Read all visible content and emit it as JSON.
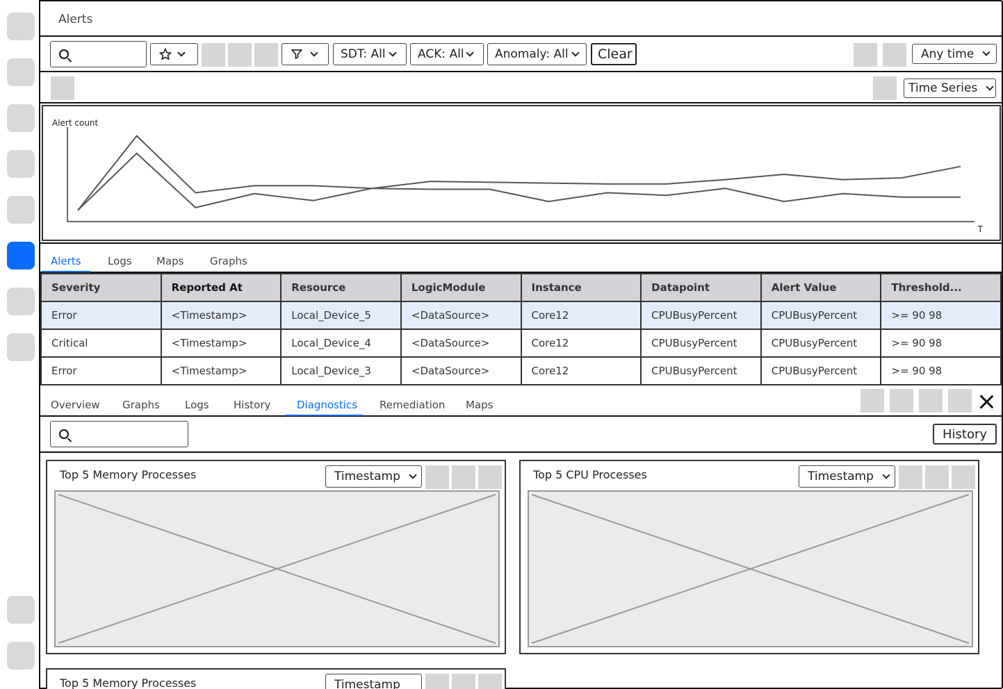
{
  "title": "Alerts",
  "toolbar": {
    "search_placeholder": "",
    "sdt_label": "SDT: All",
    "ack_label": "ACK: All",
    "anomaly_label": "Anomaly: All",
    "clear_label": "Clear",
    "time_range": "Any time"
  },
  "view": {
    "selected": "Time Series"
  },
  "chart_data": {
    "type": "line",
    "ylabel": "Alert count",
    "xlabel": "T",
    "series": [
      {
        "values": [
          0.05,
          0.9,
          0.25,
          0.33,
          0.33,
          0.3,
          0.38,
          0.37,
          0.36,
          0.35,
          0.35,
          0.4,
          0.46,
          0.4,
          0.42,
          0.55
        ]
      },
      {
        "values": [
          0.05,
          0.7,
          0.08,
          0.24,
          0.16,
          0.3,
          0.29,
          0.29,
          0.15,
          0.25,
          0.22,
          0.3,
          0.15,
          0.24,
          0.2,
          0.2
        ]
      }
    ]
  },
  "tabs_top": [
    "Alerts",
    "Logs",
    "Maps",
    "Graphs"
  ],
  "table": {
    "columns": [
      "Severity",
      "Reported At",
      "Resource",
      "LogicModule",
      "Instance",
      "Datapoint",
      "Alert Value",
      "Threshold..."
    ],
    "rows": [
      [
        "Error",
        "<Timestamp>",
        "Local_Device_5",
        "<DataSource>",
        "Core12",
        "CPUBusyPercent",
        "CPUBusyPercent",
        ">= 90 98"
      ],
      [
        "Critical",
        "<Timestamp>",
        "Local_Device_4",
        "<DataSource>",
        "Core12",
        "CPUBusyPercent",
        "CPUBusyPercent",
        ">= 90 98"
      ],
      [
        "Error",
        "<Timestamp>",
        "Local_Device_3",
        "<DataSource>",
        "Core12",
        "CPUBusyPercent",
        "CPUBusyPercent",
        ">= 90 98"
      ]
    ]
  },
  "tabs_detail": [
    "Overview",
    "Graphs",
    "Logs",
    "History",
    "Diagnostics",
    "Remediation",
    "Maps"
  ],
  "detail": {
    "history_label": "History"
  },
  "panels": [
    {
      "title": "Top 5 Memory Processes",
      "select": "Timestamp"
    },
    {
      "title": "Top 5 CPU Processes",
      "select": "Timestamp"
    },
    {
      "title": "Top 5 Memory Processes",
      "select": "Timestamp"
    }
  ],
  "icons": {
    "search": "search-icon",
    "star": "star-icon",
    "filter": "filter-icon",
    "close": "close-icon",
    "chevron": "chevron-down-icon"
  },
  "colors": {
    "accent": "#0a6cff",
    "selected_row": "#e3ecfa",
    "header_bg": "#d4d4d8"
  }
}
